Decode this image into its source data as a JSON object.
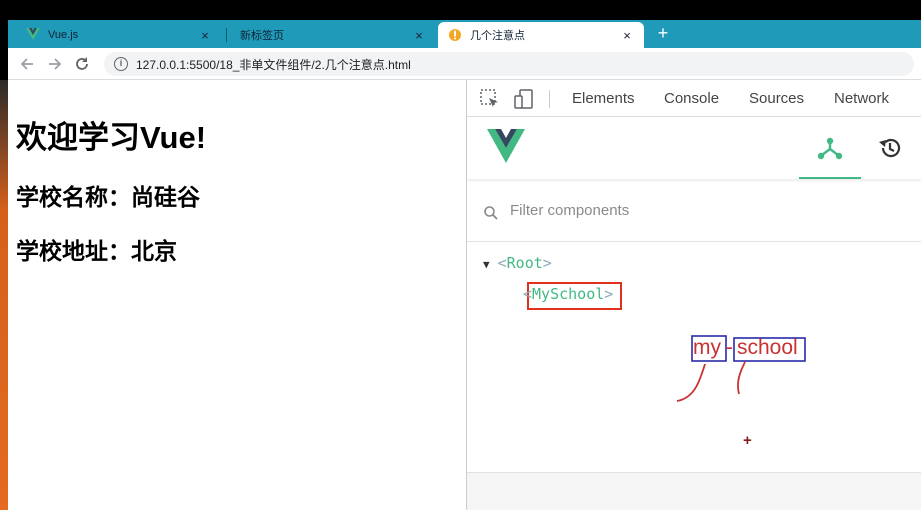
{
  "browser": {
    "tabs": [
      {
        "title": "Vue.js"
      },
      {
        "title": "新标签页"
      },
      {
        "title": "几个注意点"
      }
    ],
    "close_glyph": "×",
    "new_tab_glyph": "+",
    "address": "127.0.0.1:5500/18_非单文件组件/2.几个注意点.html",
    "info_glyph": "i"
  },
  "page": {
    "heading": "欢迎学习Vue!",
    "school_name": "学校名称：尚硅谷",
    "school_address": "学校地址：北京"
  },
  "devtools": {
    "tabs": [
      "Elements",
      "Console",
      "Sources",
      "Network"
    ],
    "filter_placeholder": "Filter components",
    "tree": {
      "expand_glyph": "▼",
      "root_open": "<",
      "root_name": "Root",
      "root_close": ">",
      "child_open": "<",
      "child_name": "MySchool",
      "child_close": ">"
    }
  },
  "annotation": {
    "word_left": "my",
    "word_right": "school",
    "hyphen": "-",
    "cursor_glyph": "+",
    "color": "#c83232",
    "box_color": "#2a2aa8"
  },
  "colors": {
    "tabstrip": "#1f9ab8",
    "vue_green": "#42b983",
    "vue_dark": "#35495e"
  }
}
